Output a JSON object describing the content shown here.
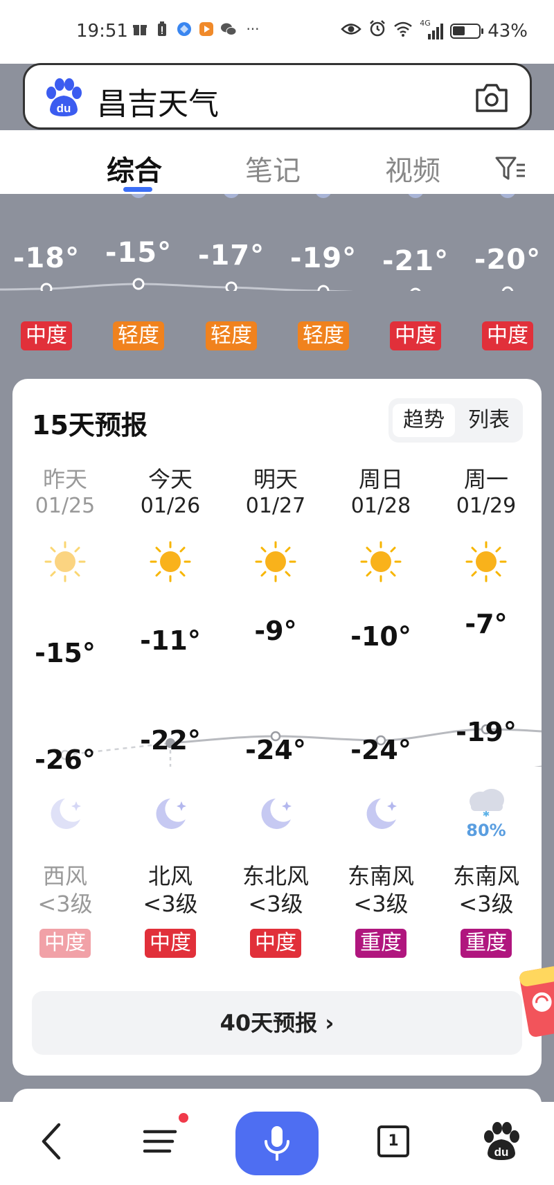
{
  "status_bar": {
    "time": "19:51",
    "more": "···",
    "network": "4G",
    "battery": "43%"
  },
  "search": {
    "query": "昌吉天气",
    "logo_text": "du"
  },
  "tabs": [
    {
      "label": "综合",
      "active": true
    },
    {
      "label": "笔记",
      "active": false
    },
    {
      "label": "视频",
      "active": false
    }
  ],
  "hourly_strip": {
    "temps": [
      "-18°",
      "-15°",
      "-17°",
      "-19°",
      "-21°",
      "-20°"
    ],
    "aqi": [
      "中度",
      "轻度",
      "轻度",
      "轻度",
      "中度",
      "中度"
    ],
    "aqi_levels": [
      "mid",
      "light",
      "light",
      "light",
      "mid",
      "mid"
    ]
  },
  "forecast": {
    "title": "15天预报",
    "toggle": {
      "trend": "趋势",
      "list": "列表"
    },
    "days": [
      {
        "name": "昨天",
        "date": "01/25",
        "high": "-15°",
        "low": "-26°",
        "wind_dir": "西风",
        "wind_level": "<3级",
        "aqi": "中度",
        "aqi_level": "pale",
        "past": true
      },
      {
        "name": "今天",
        "date": "01/26",
        "high": "-11°",
        "low": "-22°",
        "wind_dir": "北风",
        "wind_level": "<3级",
        "aqi": "中度",
        "aqi_level": "mid",
        "past": false
      },
      {
        "name": "明天",
        "date": "01/27",
        "high": "-9°",
        "low": "-24°",
        "wind_dir": "东北风",
        "wind_level": "<3级",
        "aqi": "中度",
        "aqi_level": "mid",
        "past": false
      },
      {
        "name": "周日",
        "date": "01/28",
        "high": "-10°",
        "low": "-24°",
        "wind_dir": "东南风",
        "wind_level": "<3级",
        "aqi": "重度",
        "aqi_level": "heavy",
        "past": false
      },
      {
        "name": "周一",
        "date": "01/29",
        "high": "-7°",
        "low": "-19°",
        "wind_dir": "东南风",
        "wind_level": "<3级",
        "aqi": "重度",
        "aqi_level": "heavy",
        "past": false,
        "night_snow_prob": "80%"
      }
    ],
    "more_label": "40天预报 ›"
  },
  "bottom_nav": {
    "tab_count": "1"
  },
  "colors": {
    "accent": "#4e6ef2",
    "aqi_mid": "#e1303a",
    "aqi_light": "#f0821e",
    "aqi_heavy": "#b0167e"
  },
  "icons": [
    "back-icon",
    "menu-icon",
    "mic-icon",
    "tabs-icon",
    "baidu-paw-icon",
    "camera-icon",
    "filter-icon",
    "sun-icon",
    "moon-icon",
    "snow-cloud-icon"
  ]
}
